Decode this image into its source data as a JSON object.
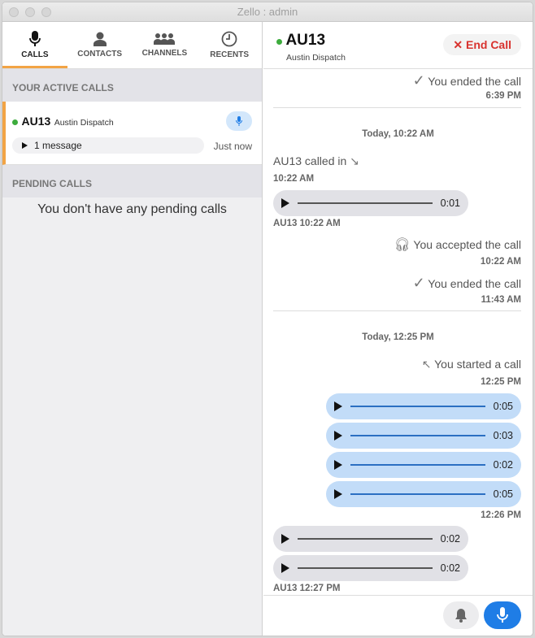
{
  "window": {
    "title": "Zello : admin"
  },
  "tabs": [
    {
      "label": "CALLS",
      "icon": "mic-icon"
    },
    {
      "label": "CONTACTS",
      "icon": "person-icon"
    },
    {
      "label": "CHANNELS",
      "icon": "group-icon"
    },
    {
      "label": "RECENTS",
      "icon": "clock-icon"
    }
  ],
  "active_section": "YOUR ACTIVE CALLS",
  "active_call": {
    "name": "AU13",
    "subtitle": "Austin Dispatch",
    "message": "1 message",
    "time": "Just now"
  },
  "pending_section": "PENDING CALLS",
  "pending_empty": "You don't have any pending calls",
  "header": {
    "name": "AU13",
    "subtitle": "Austin Dispatch",
    "end_call": "End Call"
  },
  "feed": {
    "ended1": "You ended the call",
    "ended1_time": "6:39 PM",
    "day1": "Today, 10:22 AM",
    "called_in": "AU13 called in",
    "called_in_time": "10:22 AM",
    "in_audio1": "0:01",
    "in_audio1_meta": "AU13 10:22 AM",
    "accepted": "You accepted the call",
    "accepted_time": "10:22 AM",
    "ended2": "You ended the call",
    "ended2_time": "11:43 AM",
    "day2": "Today, 12:25 PM",
    "started": "You started a call",
    "started_time": "12:25 PM",
    "out_audios": [
      "0:05",
      "0:03",
      "0:02",
      "0:05"
    ],
    "out_time": "12:26 PM",
    "in_audios": [
      "0:02",
      "0:02"
    ],
    "in_audios_meta": "AU13 12:27 PM"
  },
  "colors": {
    "accent": "#f2a445",
    "online": "#3dac3d",
    "end_call": "#d8322e",
    "ptt": "#1f7de6"
  }
}
